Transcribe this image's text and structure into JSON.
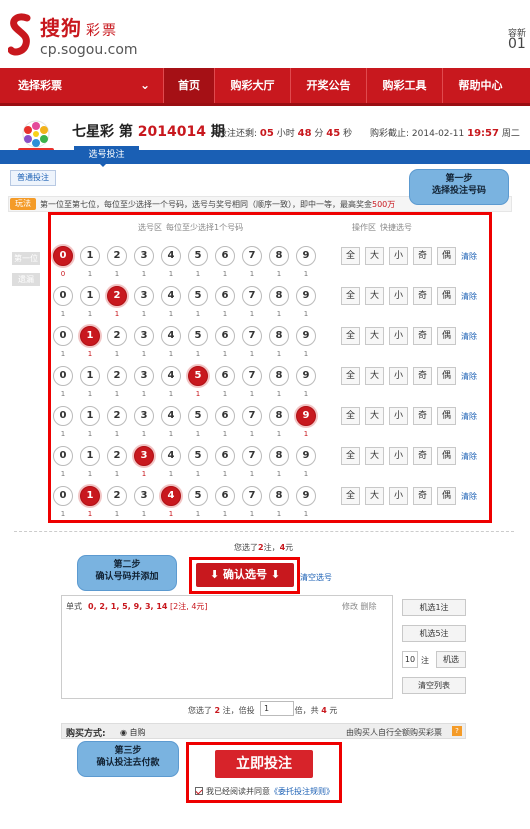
{
  "header": {
    "brand": "搜狗",
    "brand_sub": "彩票",
    "domain": "cp.sogou.com",
    "corner_top": "容新",
    "corner_bottom": "01"
  },
  "nav": {
    "select": "选择彩票",
    "items": [
      "首页",
      "购彩大厅",
      "开奖公告",
      "购彩工具",
      "帮助中心"
    ],
    "current_index": 0
  },
  "game": {
    "name": "七星彩 第",
    "issue": "2014014",
    "issue_suffix": "期",
    "countdown_label": "投注还剩:",
    "countdown_h": "05",
    "h_unit": "小时",
    "countdown_m": "48",
    "m_unit": "分",
    "countdown_s": "45",
    "s_unit": "秒",
    "deadline_label": "购彩截止:",
    "deadline_date": "2014-02-11",
    "deadline_time": "19:57",
    "deadline_suffix": "周二"
  },
  "tabs": {
    "active": "选号投注",
    "sub": "普通投注"
  },
  "hint": {
    "label": "玩法",
    "text": "第一位至第七位，每位至少选择一个号码，选号与奖号相同（顺序一致），即中一等，最高奖金",
    "prize": "500万"
  },
  "select_zone": {
    "title": "选号区",
    "hint": "每位至少选择1个号码"
  },
  "op_zone": {
    "title": "操作区",
    "hint": "快捷选号",
    "buttons": [
      "全",
      "大",
      "小",
      "奇",
      "偶"
    ],
    "clear": "清除"
  },
  "positions": [
    "第一位",
    "遗漏"
  ],
  "rows": [
    {
      "digits": [
        "0",
        "1",
        "2",
        "3",
        "4",
        "5",
        "6",
        "7",
        "8",
        "9"
      ],
      "selected": 0,
      "miss": [
        "0",
        "1",
        "1",
        "1",
        "1",
        "1",
        "1",
        "1",
        "1",
        "1"
      ]
    },
    {
      "digits": [
        "0",
        "1",
        "2",
        "3",
        "4",
        "5",
        "6",
        "7",
        "8",
        "9"
      ],
      "selected": 2,
      "miss": [
        "1",
        "1",
        "1",
        "1",
        "1",
        "1",
        "1",
        "1",
        "1",
        "1"
      ]
    },
    {
      "digits": [
        "0",
        "1",
        "2",
        "3",
        "4",
        "5",
        "6",
        "7",
        "8",
        "9"
      ],
      "selected": 1,
      "miss": [
        "1",
        "1",
        "1",
        "1",
        "1",
        "1",
        "1",
        "1",
        "1",
        "1"
      ]
    },
    {
      "digits": [
        "0",
        "1",
        "2",
        "3",
        "4",
        "5",
        "6",
        "7",
        "8",
        "9"
      ],
      "selected": 5,
      "miss": [
        "1",
        "1",
        "1",
        "1",
        "1",
        "1",
        "1",
        "1",
        "1",
        "1"
      ]
    },
    {
      "digits": [
        "0",
        "1",
        "2",
        "3",
        "4",
        "5",
        "6",
        "7",
        "8",
        "9"
      ],
      "selected": 9,
      "miss": [
        "1",
        "1",
        "1",
        "1",
        "1",
        "1",
        "1",
        "1",
        "1",
        "1"
      ]
    },
    {
      "digits": [
        "0",
        "1",
        "2",
        "3",
        "4",
        "5",
        "6",
        "7",
        "8",
        "9"
      ],
      "selected": 3,
      "miss": [
        "1",
        "1",
        "1",
        "1",
        "1",
        "1",
        "1",
        "1",
        "1",
        "1"
      ]
    },
    {
      "digits": [
        "0",
        "1",
        "2",
        "3",
        "4",
        "5",
        "6",
        "7",
        "8",
        "9"
      ],
      "selected": [
        1,
        4
      ],
      "miss": [
        "1",
        "1",
        "1",
        "1",
        "1",
        "1",
        "1",
        "1",
        "1",
        "1"
      ]
    }
  ],
  "callouts": {
    "step1": [
      "第一步",
      "选择投注号码"
    ],
    "step2": [
      "第二步",
      "确认号码并添加"
    ],
    "step3": [
      "第三步",
      "确认投注去付款"
    ]
  },
  "summary": {
    "pre": "您选了",
    "notes": "2",
    "mid": "注，",
    "amount": "4",
    "post": "元"
  },
  "confirm": {
    "label": "确认选号",
    "clear": "清空选号"
  },
  "bet": {
    "type": "单式",
    "numbers": "0, 2, 1, 5, 9, 3, 14",
    "detail": "[2注, 4元]",
    "edit": "修改",
    "del": "删除"
  },
  "random": {
    "b1": "机选1注",
    "b5": "机选5注",
    "count": "10",
    "unit": "注",
    "bN": "机选",
    "clear_list": "清空列表"
  },
  "multiplier": {
    "pre": "您选了",
    "notes": "2",
    "notes_unit": "注，倍投",
    "value": "1",
    "mid": "倍，共",
    "amount": "4",
    "post": "元"
  },
  "pay": {
    "label": "购买方式:",
    "option": "自购",
    "note": "由购买人自行全额购买彩票",
    "q": "?"
  },
  "submit": {
    "label": "立即投注"
  },
  "agree": {
    "pre": "我已经阅读并同意",
    "link": "《委托投注规则》"
  },
  "colors": {
    "brand": "#c8181e",
    "link": "#1a5fb4",
    "callout": "#7ab3e0",
    "highlight": "#e00000"
  }
}
